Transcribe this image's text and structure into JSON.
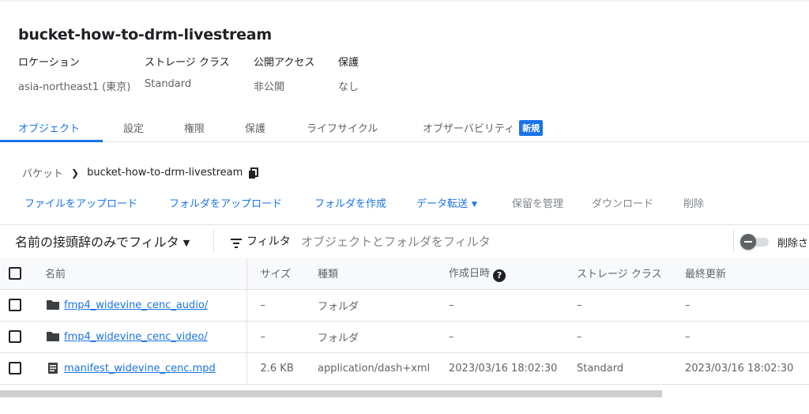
{
  "bucket": {
    "title": "bucket-how-to-drm-livestream",
    "meta": [
      {
        "label": "ロケーション",
        "value": "asia-northeast1 (東京)"
      },
      {
        "label": "ストレージ クラス",
        "value": "Standard"
      },
      {
        "label": "公開アクセス",
        "value": "非公開"
      },
      {
        "label": "保護",
        "value": "なし"
      }
    ]
  },
  "tabs": [
    {
      "label": "オブジェクト",
      "active": true
    },
    {
      "label": "設定"
    },
    {
      "label": "権限"
    },
    {
      "label": "保護"
    },
    {
      "label": "ライフサイクル"
    },
    {
      "label": "オブザーバビリティ",
      "badge": "新規"
    }
  ],
  "breadcrumb": {
    "root": "バケット",
    "current": "bucket-how-to-drm-livestream",
    "copy_icon": "copy-icon"
  },
  "actions": {
    "upload_files": "ファイルをアップロード",
    "upload_folder": "フォルダをアップロード",
    "create_folder": "フォルダを作成",
    "transfer_data": "データ転送",
    "manage_holds": "保留を管理",
    "download": "ダウンロード",
    "delete": "削除"
  },
  "filter": {
    "prefix_filter": "名前の接頭辞のみでフィルタ",
    "filter_label": "フィルタ",
    "placeholder": "オブジェクトとフォルダをフィルタ",
    "toggle_label": "削除さ"
  },
  "table": {
    "columns": {
      "name": "名前",
      "size": "サイズ",
      "type": "種類",
      "created": "作成日時",
      "storage_class": "ストレージ クラス",
      "updated": "最終更新"
    },
    "rows": [
      {
        "icon": "folder-icon",
        "name": "fmp4_widevine_cenc_audio/",
        "size": "–",
        "type": "フォルダ",
        "created": "–",
        "storage_class": "–",
        "updated": "–"
      },
      {
        "icon": "folder-icon",
        "name": "fmp4_widevine_cenc_video/",
        "size": "–",
        "type": "フォルダ",
        "created": "–",
        "storage_class": "–",
        "updated": "–"
      },
      {
        "icon": "file-icon",
        "name": "manifest_widevine_cenc.mpd",
        "size": "2.6 KB",
        "type": "application/dash+xml",
        "created": "2023/03/16 18:02:30",
        "storage_class": "Standard",
        "updated": "2023/03/16 18:02:30"
      }
    ]
  },
  "colors": {
    "accent": "#1a73e8",
    "text": "#202124",
    "muted": "#5f6368"
  }
}
